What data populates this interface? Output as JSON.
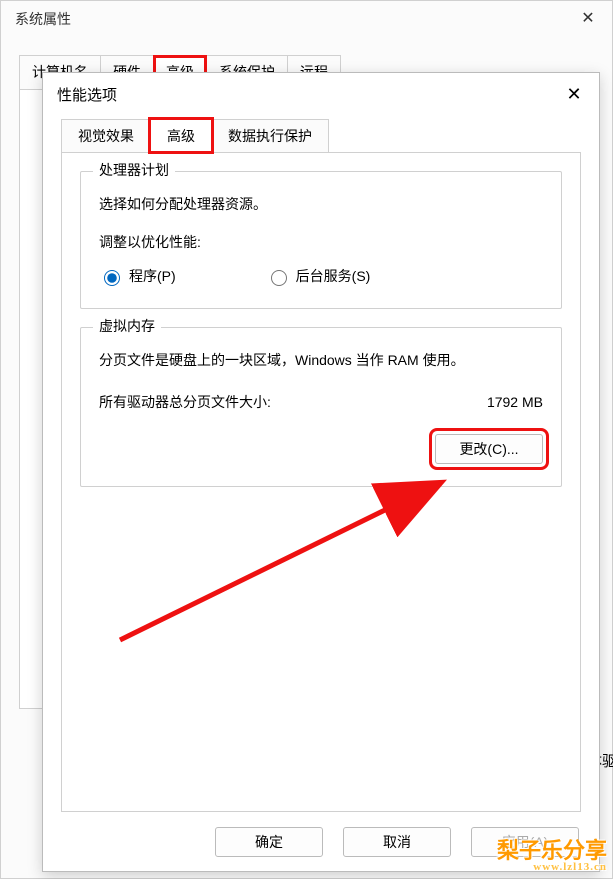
{
  "outer": {
    "title": "系统属性",
    "tabs": [
      "计算机名",
      "硬件",
      "高级",
      "系统保护",
      "远程"
    ],
    "active_tab_index": 2,
    "close": "✕"
  },
  "inner": {
    "title": "性能选项",
    "close": "✕",
    "tabs": [
      "视觉效果",
      "高级",
      "数据执行保护"
    ],
    "active_tab_index": 1
  },
  "cpu_group": {
    "legend": "处理器计划",
    "desc": "选择如何分配处理器资源。",
    "adjust_label": "调整以优化性能:",
    "radio_programs": "程序(P)",
    "radio_bg": "后台服务(S)",
    "selected": "programs"
  },
  "vm_group": {
    "legend": "虚拟内存",
    "desc": "分页文件是硬盘上的一块区域，Windows 当作 RAM 使用。",
    "total_label": "所有驱动器总分页文件大小:",
    "total_value": "1792 MB",
    "change_btn": "更改(C)..."
  },
  "buttons": {
    "ok": "确定",
    "cancel": "取消",
    "apply": "应用(A)"
  },
  "side_text": "能体驱",
  "watermark": {
    "main": "梨子乐分享",
    "sub": "www.lzl13.cn"
  }
}
